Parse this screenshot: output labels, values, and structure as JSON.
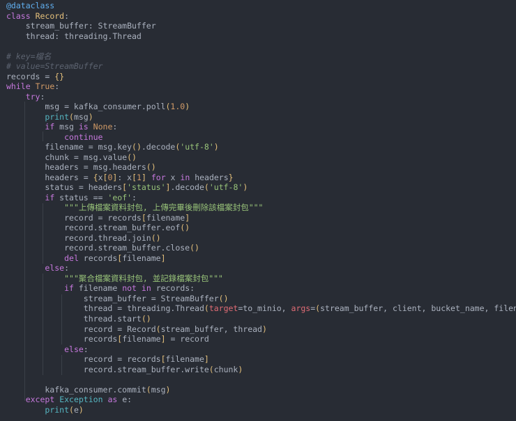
{
  "editor": {
    "theme": "dark",
    "background": "#282c34",
    "colors": {
      "plain": "#abb2bf",
      "keyword": "#c678dd",
      "decorator": "#61afef",
      "class": "#e5c07b",
      "function": "#61afef",
      "builtin": "#56b6c2",
      "number": "#d19a66",
      "string": "#98c379",
      "comment": "#5c6370",
      "bracket": "#e5c07b",
      "param": "#e06c75"
    },
    "lines": [
      [
        [
          "deco",
          "@dataclass"
        ]
      ],
      [
        [
          "keyword",
          "class"
        ],
        [
          "plain",
          " "
        ],
        [
          "class",
          "Record"
        ],
        [
          "plain",
          ":"
        ]
      ],
      [
        [
          "plain",
          "    stream_buffer: StreamBuffer"
        ]
      ],
      [
        [
          "plain",
          "    thread: threading.Thread"
        ]
      ],
      [],
      [
        [
          "comment",
          "# key=檔名"
        ]
      ],
      [
        [
          "comment",
          "# value=StreamBuffer"
        ]
      ],
      [
        [
          "plain",
          "records = "
        ],
        [
          "bracket",
          "{}"
        ]
      ],
      [
        [
          "keyword",
          "while"
        ],
        [
          "plain",
          " "
        ],
        [
          "const",
          "True"
        ],
        [
          "plain",
          ":"
        ]
      ],
      [
        [
          "plain",
          "    "
        ],
        [
          "keyword",
          "try"
        ],
        [
          "plain",
          ":"
        ]
      ],
      [
        [
          "plain",
          "        msg = kafka_consumer.poll"
        ],
        [
          "bracket",
          "("
        ],
        [
          "number",
          "1.0"
        ],
        [
          "bracket",
          ")"
        ]
      ],
      [
        [
          "plain",
          "        "
        ],
        [
          "builtin",
          "print"
        ],
        [
          "bracket",
          "("
        ],
        [
          "plain",
          "msg"
        ],
        [
          "bracket",
          ")"
        ]
      ],
      [
        [
          "plain",
          "        "
        ],
        [
          "keyword",
          "if"
        ],
        [
          "plain",
          " msg "
        ],
        [
          "keyword",
          "is"
        ],
        [
          "plain",
          " "
        ],
        [
          "const",
          "None"
        ],
        [
          "plain",
          ":"
        ]
      ],
      [
        [
          "plain",
          "            "
        ],
        [
          "keyword",
          "continue"
        ]
      ],
      [
        [
          "plain",
          "        filename = msg.key"
        ],
        [
          "bracket",
          "()"
        ],
        [
          "plain",
          ".decode"
        ],
        [
          "bracket",
          "("
        ],
        [
          "string",
          "'utf-8'"
        ],
        [
          "bracket",
          ")"
        ]
      ],
      [
        [
          "plain",
          "        chunk = msg.value"
        ],
        [
          "bracket",
          "()"
        ]
      ],
      [
        [
          "plain",
          "        headers = msg.headers"
        ],
        [
          "bracket",
          "()"
        ]
      ],
      [
        [
          "plain",
          "        headers = "
        ],
        [
          "bracket",
          "{"
        ],
        [
          "plain",
          "x"
        ],
        [
          "bracket",
          "["
        ],
        [
          "number",
          "0"
        ],
        [
          "bracket",
          "]"
        ],
        [
          "plain",
          ": x"
        ],
        [
          "bracket",
          "["
        ],
        [
          "number",
          "1"
        ],
        [
          "bracket",
          "]"
        ],
        [
          "plain",
          " "
        ],
        [
          "keyword",
          "for"
        ],
        [
          "plain",
          " x "
        ],
        [
          "keyword",
          "in"
        ],
        [
          "plain",
          " headers"
        ],
        [
          "bracket",
          "}"
        ]
      ],
      [
        [
          "plain",
          "        status = headers"
        ],
        [
          "bracket",
          "["
        ],
        [
          "string",
          "'status'"
        ],
        [
          "bracket",
          "]"
        ],
        [
          "plain",
          ".decode"
        ],
        [
          "bracket",
          "("
        ],
        [
          "string",
          "'utf-8'"
        ],
        [
          "bracket",
          ")"
        ]
      ],
      [
        [
          "plain",
          "        "
        ],
        [
          "keyword",
          "if"
        ],
        [
          "plain",
          " status == "
        ],
        [
          "string",
          "'eof'"
        ],
        [
          "plain",
          ":"
        ]
      ],
      [
        [
          "plain",
          "            "
        ],
        [
          "string",
          "\"\"\"上傳檔案資料封包, 上傳完畢後刪除該檔案封包\"\"\""
        ]
      ],
      [
        [
          "plain",
          "            record = records"
        ],
        [
          "bracket",
          "["
        ],
        [
          "plain",
          "filename"
        ],
        [
          "bracket",
          "]"
        ]
      ],
      [
        [
          "plain",
          "            record.stream_buffer.eof"
        ],
        [
          "bracket",
          "()"
        ]
      ],
      [
        [
          "plain",
          "            record.thread.join"
        ],
        [
          "bracket",
          "()"
        ]
      ],
      [
        [
          "plain",
          "            record.stream_buffer.close"
        ],
        [
          "bracket",
          "()"
        ]
      ],
      [
        [
          "plain",
          "            "
        ],
        [
          "keyword",
          "del"
        ],
        [
          "plain",
          " records"
        ],
        [
          "bracket",
          "["
        ],
        [
          "plain",
          "filename"
        ],
        [
          "bracket",
          "]"
        ]
      ],
      [
        [
          "plain",
          "        "
        ],
        [
          "keyword",
          "else"
        ],
        [
          "plain",
          ":"
        ]
      ],
      [
        [
          "plain",
          "            "
        ],
        [
          "string",
          "\"\"\"聚合檔案資料封包, 並記錄檔案封包\"\"\""
        ]
      ],
      [
        [
          "plain",
          "            "
        ],
        [
          "keyword",
          "if"
        ],
        [
          "plain",
          " filename "
        ],
        [
          "keyword",
          "not"
        ],
        [
          "plain",
          " "
        ],
        [
          "keyword",
          "in"
        ],
        [
          "plain",
          " records:"
        ]
      ],
      [
        [
          "plain",
          "                stream_buffer = StreamBuffer"
        ],
        [
          "bracket",
          "()"
        ]
      ],
      [
        [
          "plain",
          "                thread = threading.Thread"
        ],
        [
          "bracket",
          "("
        ],
        [
          "param",
          "target"
        ],
        [
          "plain",
          "=to_minio, "
        ],
        [
          "param",
          "args"
        ],
        [
          "plain",
          "="
        ],
        [
          "bracket",
          "("
        ],
        [
          "plain",
          "stream_buffer, client, bucket_name, filename"
        ],
        [
          "bracket",
          "))"
        ]
      ],
      [
        [
          "plain",
          "                thread.start"
        ],
        [
          "bracket",
          "()"
        ]
      ],
      [
        [
          "plain",
          "                record = Record"
        ],
        [
          "bracket",
          "("
        ],
        [
          "plain",
          "stream_buffer, thread"
        ],
        [
          "bracket",
          ")"
        ]
      ],
      [
        [
          "plain",
          "                records"
        ],
        [
          "bracket",
          "["
        ],
        [
          "plain",
          "filename"
        ],
        [
          "bracket",
          "]"
        ],
        [
          "plain",
          " = record"
        ]
      ],
      [
        [
          "plain",
          "            "
        ],
        [
          "keyword",
          "else"
        ],
        [
          "plain",
          ":"
        ]
      ],
      [
        [
          "plain",
          "                record = records"
        ],
        [
          "bracket",
          "["
        ],
        [
          "plain",
          "filename"
        ],
        [
          "bracket",
          "]"
        ]
      ],
      [
        [
          "plain",
          "                record.stream_buffer.write"
        ],
        [
          "bracket",
          "("
        ],
        [
          "plain",
          "chunk"
        ],
        [
          "bracket",
          ")"
        ]
      ],
      [],
      [
        [
          "plain",
          "        kafka_consumer.commit"
        ],
        [
          "bracket",
          "("
        ],
        [
          "plain",
          "msg"
        ],
        [
          "bracket",
          ")"
        ]
      ],
      [
        [
          "plain",
          "    "
        ],
        [
          "keyword",
          "except"
        ],
        [
          "plain",
          " "
        ],
        [
          "builtin",
          "Exception"
        ],
        [
          "plain",
          " "
        ],
        [
          "keyword",
          "as"
        ],
        [
          "plain",
          " e:"
        ]
      ],
      [
        [
          "plain",
          "        "
        ],
        [
          "builtin",
          "print"
        ],
        [
          "bracket",
          "("
        ],
        [
          "plain",
          "e"
        ],
        [
          "bracket",
          ")"
        ]
      ]
    ]
  }
}
